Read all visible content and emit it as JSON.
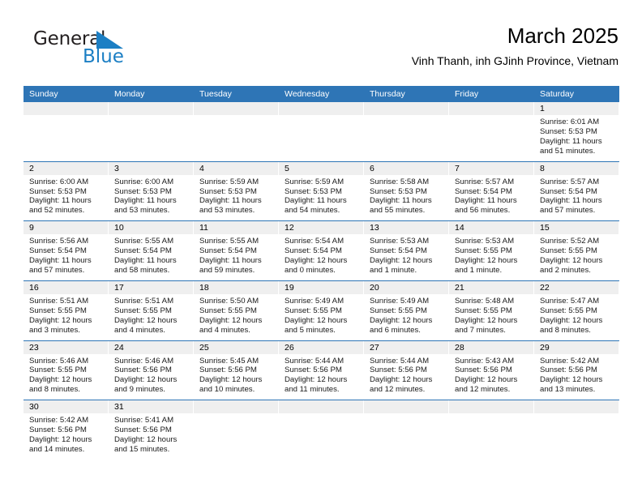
{
  "logo": {
    "word1": "General",
    "word2": "Blue",
    "flag_color": "#1c7fc4",
    "text_color": "#231f20"
  },
  "header": {
    "title": "March 2025",
    "subtitle": "Vinh Thanh, inh GJinh Province, Vietnam"
  },
  "theme": {
    "header_blue": "#2e75b6",
    "date_band": "#efefef",
    "separator": "#2e75b6"
  },
  "weekdays": [
    "Sunday",
    "Monday",
    "Tuesday",
    "Wednesday",
    "Thursday",
    "Friday",
    "Saturday"
  ],
  "weeks": [
    [
      {
        "day": "",
        "sunrise": "",
        "sunset": "",
        "daylight1": "",
        "daylight2": ""
      },
      {
        "day": "",
        "sunrise": "",
        "sunset": "",
        "daylight1": "",
        "daylight2": ""
      },
      {
        "day": "",
        "sunrise": "",
        "sunset": "",
        "daylight1": "",
        "daylight2": ""
      },
      {
        "day": "",
        "sunrise": "",
        "sunset": "",
        "daylight1": "",
        "daylight2": ""
      },
      {
        "day": "",
        "sunrise": "",
        "sunset": "",
        "daylight1": "",
        "daylight2": ""
      },
      {
        "day": "",
        "sunrise": "",
        "sunset": "",
        "daylight1": "",
        "daylight2": ""
      },
      {
        "day": "1",
        "sunrise": "Sunrise: 6:01 AM",
        "sunset": "Sunset: 5:53 PM",
        "daylight1": "Daylight: 11 hours",
        "daylight2": "and 51 minutes."
      }
    ],
    [
      {
        "day": "2",
        "sunrise": "Sunrise: 6:00 AM",
        "sunset": "Sunset: 5:53 PM",
        "daylight1": "Daylight: 11 hours",
        "daylight2": "and 52 minutes."
      },
      {
        "day": "3",
        "sunrise": "Sunrise: 6:00 AM",
        "sunset": "Sunset: 5:53 PM",
        "daylight1": "Daylight: 11 hours",
        "daylight2": "and 53 minutes."
      },
      {
        "day": "4",
        "sunrise": "Sunrise: 5:59 AM",
        "sunset": "Sunset: 5:53 PM",
        "daylight1": "Daylight: 11 hours",
        "daylight2": "and 53 minutes."
      },
      {
        "day": "5",
        "sunrise": "Sunrise: 5:59 AM",
        "sunset": "Sunset: 5:53 PM",
        "daylight1": "Daylight: 11 hours",
        "daylight2": "and 54 minutes."
      },
      {
        "day": "6",
        "sunrise": "Sunrise: 5:58 AM",
        "sunset": "Sunset: 5:53 PM",
        "daylight1": "Daylight: 11 hours",
        "daylight2": "and 55 minutes."
      },
      {
        "day": "7",
        "sunrise": "Sunrise: 5:57 AM",
        "sunset": "Sunset: 5:54 PM",
        "daylight1": "Daylight: 11 hours",
        "daylight2": "and 56 minutes."
      },
      {
        "day": "8",
        "sunrise": "Sunrise: 5:57 AM",
        "sunset": "Sunset: 5:54 PM",
        "daylight1": "Daylight: 11 hours",
        "daylight2": "and 57 minutes."
      }
    ],
    [
      {
        "day": "9",
        "sunrise": "Sunrise: 5:56 AM",
        "sunset": "Sunset: 5:54 PM",
        "daylight1": "Daylight: 11 hours",
        "daylight2": "and 57 minutes."
      },
      {
        "day": "10",
        "sunrise": "Sunrise: 5:55 AM",
        "sunset": "Sunset: 5:54 PM",
        "daylight1": "Daylight: 11 hours",
        "daylight2": "and 58 minutes."
      },
      {
        "day": "11",
        "sunrise": "Sunrise: 5:55 AM",
        "sunset": "Sunset: 5:54 PM",
        "daylight1": "Daylight: 11 hours",
        "daylight2": "and 59 minutes."
      },
      {
        "day": "12",
        "sunrise": "Sunrise: 5:54 AM",
        "sunset": "Sunset: 5:54 PM",
        "daylight1": "Daylight: 12 hours",
        "daylight2": "and 0 minutes."
      },
      {
        "day": "13",
        "sunrise": "Sunrise: 5:53 AM",
        "sunset": "Sunset: 5:54 PM",
        "daylight1": "Daylight: 12 hours",
        "daylight2": "and 1 minute."
      },
      {
        "day": "14",
        "sunrise": "Sunrise: 5:53 AM",
        "sunset": "Sunset: 5:55 PM",
        "daylight1": "Daylight: 12 hours",
        "daylight2": "and 1 minute."
      },
      {
        "day": "15",
        "sunrise": "Sunrise: 5:52 AM",
        "sunset": "Sunset: 5:55 PM",
        "daylight1": "Daylight: 12 hours",
        "daylight2": "and 2 minutes."
      }
    ],
    [
      {
        "day": "16",
        "sunrise": "Sunrise: 5:51 AM",
        "sunset": "Sunset: 5:55 PM",
        "daylight1": "Daylight: 12 hours",
        "daylight2": "and 3 minutes."
      },
      {
        "day": "17",
        "sunrise": "Sunrise: 5:51 AM",
        "sunset": "Sunset: 5:55 PM",
        "daylight1": "Daylight: 12 hours",
        "daylight2": "and 4 minutes."
      },
      {
        "day": "18",
        "sunrise": "Sunrise: 5:50 AM",
        "sunset": "Sunset: 5:55 PM",
        "daylight1": "Daylight: 12 hours",
        "daylight2": "and 4 minutes."
      },
      {
        "day": "19",
        "sunrise": "Sunrise: 5:49 AM",
        "sunset": "Sunset: 5:55 PM",
        "daylight1": "Daylight: 12 hours",
        "daylight2": "and 5 minutes."
      },
      {
        "day": "20",
        "sunrise": "Sunrise: 5:49 AM",
        "sunset": "Sunset: 5:55 PM",
        "daylight1": "Daylight: 12 hours",
        "daylight2": "and 6 minutes."
      },
      {
        "day": "21",
        "sunrise": "Sunrise: 5:48 AM",
        "sunset": "Sunset: 5:55 PM",
        "daylight1": "Daylight: 12 hours",
        "daylight2": "and 7 minutes."
      },
      {
        "day": "22",
        "sunrise": "Sunrise: 5:47 AM",
        "sunset": "Sunset: 5:55 PM",
        "daylight1": "Daylight: 12 hours",
        "daylight2": "and 8 minutes."
      }
    ],
    [
      {
        "day": "23",
        "sunrise": "Sunrise: 5:46 AM",
        "sunset": "Sunset: 5:55 PM",
        "daylight1": "Daylight: 12 hours",
        "daylight2": "and 8 minutes."
      },
      {
        "day": "24",
        "sunrise": "Sunrise: 5:46 AM",
        "sunset": "Sunset: 5:56 PM",
        "daylight1": "Daylight: 12 hours",
        "daylight2": "and 9 minutes."
      },
      {
        "day": "25",
        "sunrise": "Sunrise: 5:45 AM",
        "sunset": "Sunset: 5:56 PM",
        "daylight1": "Daylight: 12 hours",
        "daylight2": "and 10 minutes."
      },
      {
        "day": "26",
        "sunrise": "Sunrise: 5:44 AM",
        "sunset": "Sunset: 5:56 PM",
        "daylight1": "Daylight: 12 hours",
        "daylight2": "and 11 minutes."
      },
      {
        "day": "27",
        "sunrise": "Sunrise: 5:44 AM",
        "sunset": "Sunset: 5:56 PM",
        "daylight1": "Daylight: 12 hours",
        "daylight2": "and 12 minutes."
      },
      {
        "day": "28",
        "sunrise": "Sunrise: 5:43 AM",
        "sunset": "Sunset: 5:56 PM",
        "daylight1": "Daylight: 12 hours",
        "daylight2": "and 12 minutes."
      },
      {
        "day": "29",
        "sunrise": "Sunrise: 5:42 AM",
        "sunset": "Sunset: 5:56 PM",
        "daylight1": "Daylight: 12 hours",
        "daylight2": "and 13 minutes."
      }
    ],
    [
      {
        "day": "30",
        "sunrise": "Sunrise: 5:42 AM",
        "sunset": "Sunset: 5:56 PM",
        "daylight1": "Daylight: 12 hours",
        "daylight2": "and 14 minutes."
      },
      {
        "day": "31",
        "sunrise": "Sunrise: 5:41 AM",
        "sunset": "Sunset: 5:56 PM",
        "daylight1": "Daylight: 12 hours",
        "daylight2": "and 15 minutes."
      },
      {
        "day": "",
        "sunrise": "",
        "sunset": "",
        "daylight1": "",
        "daylight2": ""
      },
      {
        "day": "",
        "sunrise": "",
        "sunset": "",
        "daylight1": "",
        "daylight2": ""
      },
      {
        "day": "",
        "sunrise": "",
        "sunset": "",
        "daylight1": "",
        "daylight2": ""
      },
      {
        "day": "",
        "sunrise": "",
        "sunset": "",
        "daylight1": "",
        "daylight2": ""
      },
      {
        "day": "",
        "sunrise": "",
        "sunset": "",
        "daylight1": "",
        "daylight2": ""
      }
    ]
  ]
}
